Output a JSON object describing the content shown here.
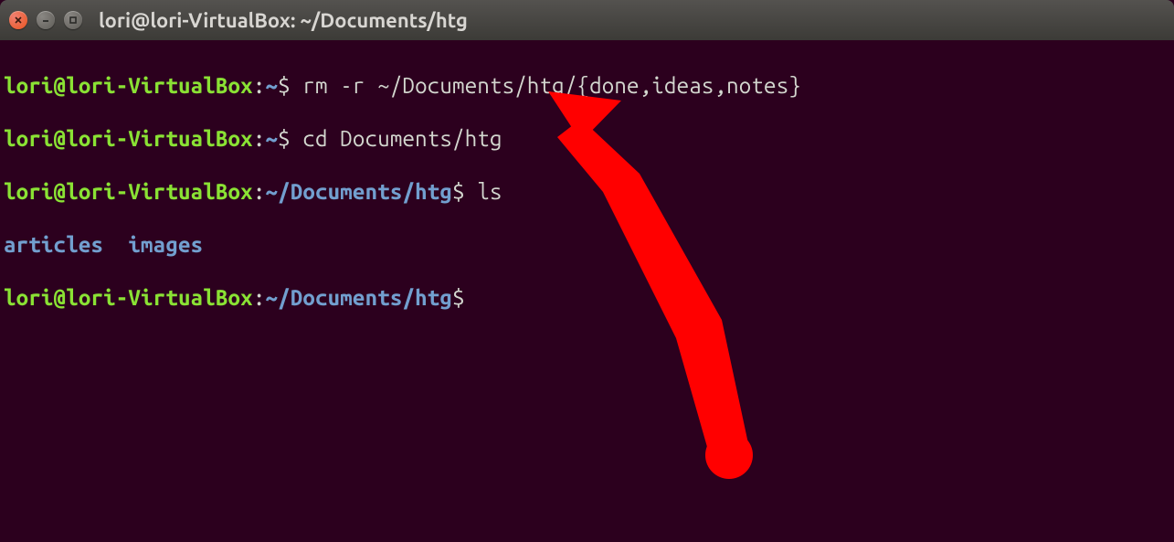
{
  "window": {
    "title": "lori@lori-VirtualBox: ~/Documents/htg"
  },
  "terminal": {
    "lines": [
      {
        "user_host": "lori@lori-VirtualBox",
        "path": "~",
        "prompt": "$ ",
        "command": "rm -r ~/Documents/htg/{done,ideas,notes}"
      },
      {
        "user_host": "lori@lori-VirtualBox",
        "path": "~",
        "prompt": "$ ",
        "command": "cd Documents/htg"
      },
      {
        "user_host": "lori@lori-VirtualBox",
        "path": "~/Documents/htg",
        "prompt": "$ ",
        "command": "ls"
      }
    ],
    "ls_output": [
      "articles",
      "images"
    ],
    "current_prompt": {
      "user_host": "lori@lori-VirtualBox",
      "path": "~/Documents/htg",
      "prompt": "$ "
    }
  },
  "annotation": {
    "arrow_color": "#ff0000"
  }
}
